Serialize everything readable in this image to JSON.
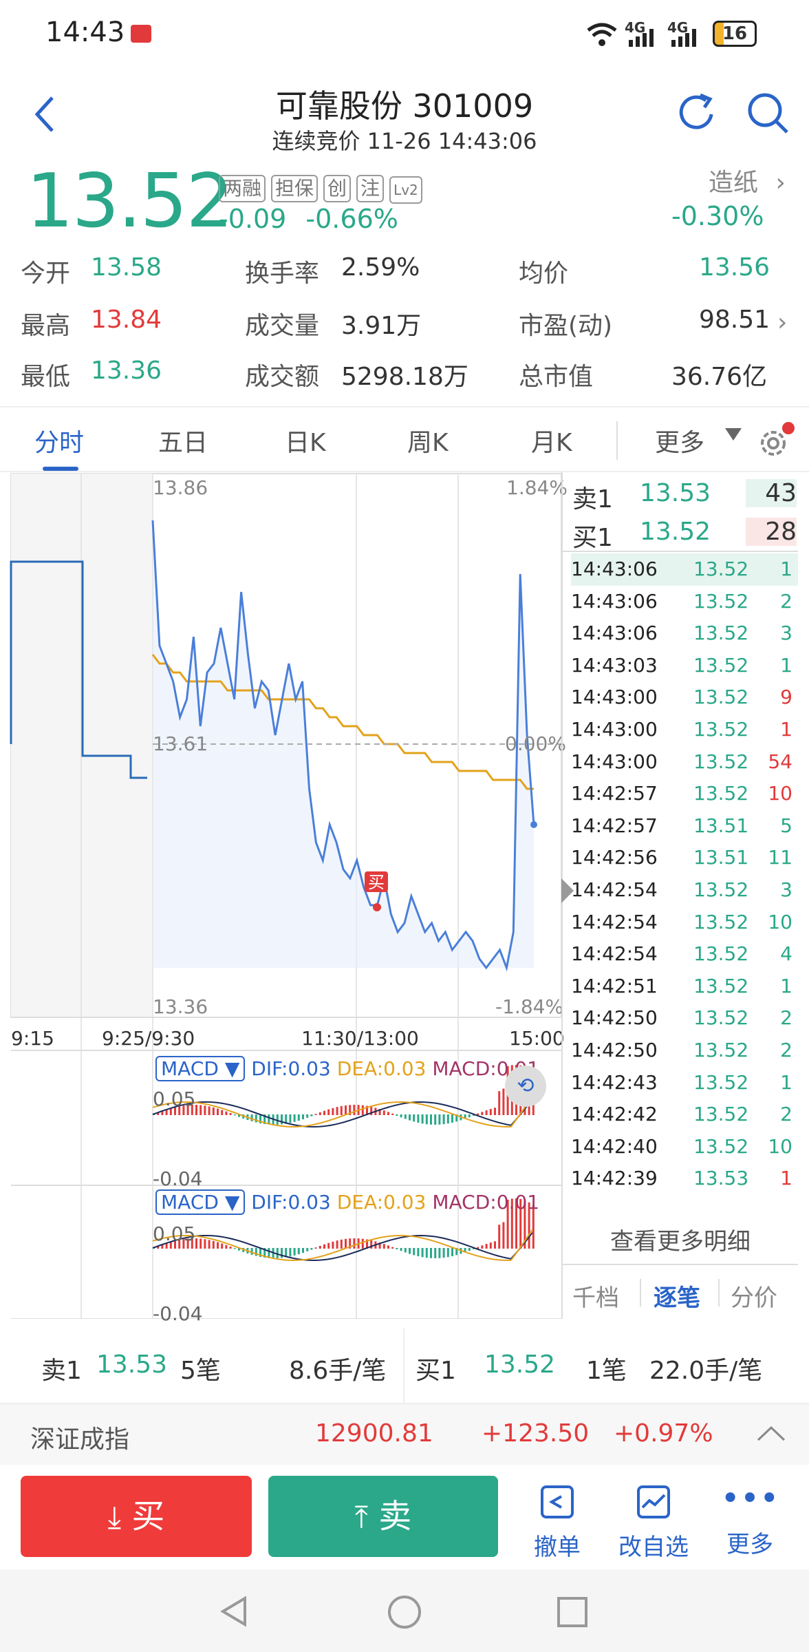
{
  "status": {
    "time": "14:43",
    "battery": "16",
    "net1": "4G",
    "net2": "4G"
  },
  "header": {
    "title": "可靠股份 301009",
    "subtitle": "连续竞价 11-26 14:43:06"
  },
  "quote": {
    "price": "13.52",
    "change": "-0.09",
    "change_pct": "-0.66%",
    "tags": [
      "两融",
      "担保",
      "创",
      "注",
      "Lv2"
    ],
    "sector_name": "造纸",
    "sector_pct": "-0.30%"
  },
  "stats": {
    "open_label": "今开",
    "open": "13.58",
    "high_label": "最高",
    "high": "13.84",
    "low_label": "最低",
    "low": "13.36",
    "turnover_label": "换手率",
    "turnover": "2.59%",
    "volume_label": "成交量",
    "volume": "3.91万",
    "amount_label": "成交额",
    "amount": "5298.18万",
    "avg_label": "均价",
    "avg": "13.56",
    "pe_label": "市盈(动)",
    "pe": "98.51",
    "mcap_label": "总市值",
    "mcap": "36.76亿"
  },
  "tabs": [
    "分时",
    "五日",
    "日K",
    "周K",
    "月K",
    "更多"
  ],
  "chart_data": {
    "type": "line",
    "y_labels": {
      "top": "13.86",
      "mid": "13.61",
      "bottom": "13.36"
    },
    "pct_labels": {
      "top": "1.84%",
      "mid": "0.00%",
      "bottom": "-1.84%"
    },
    "x_labels": [
      "9:15",
      "9:25/9:30",
      "11:30/13:00",
      "15:00"
    ],
    "buy_marker": "买",
    "price_series": [
      13.86,
      13.72,
      13.7,
      13.68,
      13.64,
      13.66,
      13.73,
      13.63,
      13.69,
      13.7,
      13.74,
      13.7,
      13.66,
      13.78,
      13.71,
      13.65,
      13.68,
      13.67,
      13.62,
      13.66,
      13.7,
      13.66,
      13.68,
      13.56,
      13.5,
      13.48,
      13.52,
      13.5,
      13.47,
      13.46,
      13.48,
      13.45,
      13.43,
      13.43,
      13.46,
      13.42,
      13.4,
      13.41,
      13.44,
      13.42,
      13.4,
      13.41,
      13.39,
      13.4,
      13.38,
      13.39,
      13.4,
      13.39,
      13.37,
      13.36,
      13.37,
      13.38,
      13.36,
      13.4,
      13.8,
      13.62,
      13.52
    ],
    "avg_series": [
      13.71,
      13.7,
      13.7,
      13.69,
      13.69,
      13.68,
      13.68,
      13.68,
      13.68,
      13.68,
      13.68,
      13.67,
      13.67,
      13.67,
      13.67,
      13.67,
      13.67,
      13.66,
      13.66,
      13.66,
      13.66,
      13.66,
      13.66,
      13.66,
      13.65,
      13.65,
      13.64,
      13.64,
      13.63,
      13.63,
      13.63,
      13.62,
      13.62,
      13.62,
      13.61,
      13.61,
      13.61,
      13.6,
      13.6,
      13.6,
      13.6,
      13.59,
      13.59,
      13.59,
      13.59,
      13.58,
      13.58,
      13.58,
      13.58,
      13.58,
      13.57,
      13.57,
      13.57,
      13.57,
      13.57,
      13.56,
      13.56
    ]
  },
  "macd": {
    "label": "MACD",
    "dif": "DIF:0.03",
    "dea": "DEA:0.03",
    "macd": "MACD:0.01",
    "top": "0.05",
    "bottom": "-0.04"
  },
  "order_book": {
    "sell_label": "卖1",
    "sell_price": "13.53",
    "sell_vol": "43",
    "buy_label": "买1",
    "buy_price": "13.52",
    "buy_vol": "28"
  },
  "ticks": [
    {
      "t": "14:43:06",
      "p": "13.52",
      "v": "1",
      "c": "g"
    },
    {
      "t": "14:43:06",
      "p": "13.52",
      "v": "2",
      "c": "g"
    },
    {
      "t": "14:43:06",
      "p": "13.52",
      "v": "3",
      "c": "g"
    },
    {
      "t": "14:43:03",
      "p": "13.52",
      "v": "1",
      "c": "g"
    },
    {
      "t": "14:43:00",
      "p": "13.52",
      "v": "9",
      "c": "r"
    },
    {
      "t": "14:43:00",
      "p": "13.52",
      "v": "1",
      "c": "r"
    },
    {
      "t": "14:43:00",
      "p": "13.52",
      "v": "54",
      "c": "r"
    },
    {
      "t": "14:42:57",
      "p": "13.52",
      "v": "10",
      "c": "r"
    },
    {
      "t": "14:42:57",
      "p": "13.51",
      "v": "5",
      "c": "g"
    },
    {
      "t": "14:42:56",
      "p": "13.51",
      "v": "11",
      "c": "g"
    },
    {
      "t": "14:42:54",
      "p": "13.52",
      "v": "3",
      "c": "g"
    },
    {
      "t": "14:42:54",
      "p": "13.52",
      "v": "10",
      "c": "g"
    },
    {
      "t": "14:42:54",
      "p": "13.52",
      "v": "4",
      "c": "g"
    },
    {
      "t": "14:42:51",
      "p": "13.52",
      "v": "1",
      "c": "g"
    },
    {
      "t": "14:42:50",
      "p": "13.52",
      "v": "2",
      "c": "g"
    },
    {
      "t": "14:42:50",
      "p": "13.52",
      "v": "2",
      "c": "g"
    },
    {
      "t": "14:42:43",
      "p": "13.52",
      "v": "1",
      "c": "g"
    },
    {
      "t": "14:42:42",
      "p": "13.52",
      "v": "2",
      "c": "g"
    },
    {
      "t": "14:42:40",
      "p": "13.52",
      "v": "10",
      "c": "g"
    },
    {
      "t": "14:42:39",
      "p": "13.53",
      "v": "1",
      "c": "r"
    }
  ],
  "more_detail": "查看更多明细",
  "detail_tabs": [
    "千档",
    "逐笔",
    "分价"
  ],
  "bid_ask_summary": {
    "sell_label": "卖1",
    "sell_price": "13.53",
    "sell_count": "5笔",
    "sell_avg": "8.6手/笔",
    "buy_label": "买1",
    "buy_price": "13.52",
    "buy_count": "1笔",
    "buy_avg": "22.0手/笔"
  },
  "index_bar": {
    "name": "深证成指",
    "value": "12900.81",
    "change": "+123.50",
    "pct": "+0.97%"
  },
  "actions": {
    "buy": "买",
    "sell": "卖",
    "cancel": "撤单",
    "watchlist": "改自选",
    "more": "更多"
  },
  "colors": {
    "green": "#2aa889",
    "red": "#e23a3a",
    "blue": "#2a64c8",
    "line": "#4a7fd9",
    "avg": "#e3a21a"
  }
}
